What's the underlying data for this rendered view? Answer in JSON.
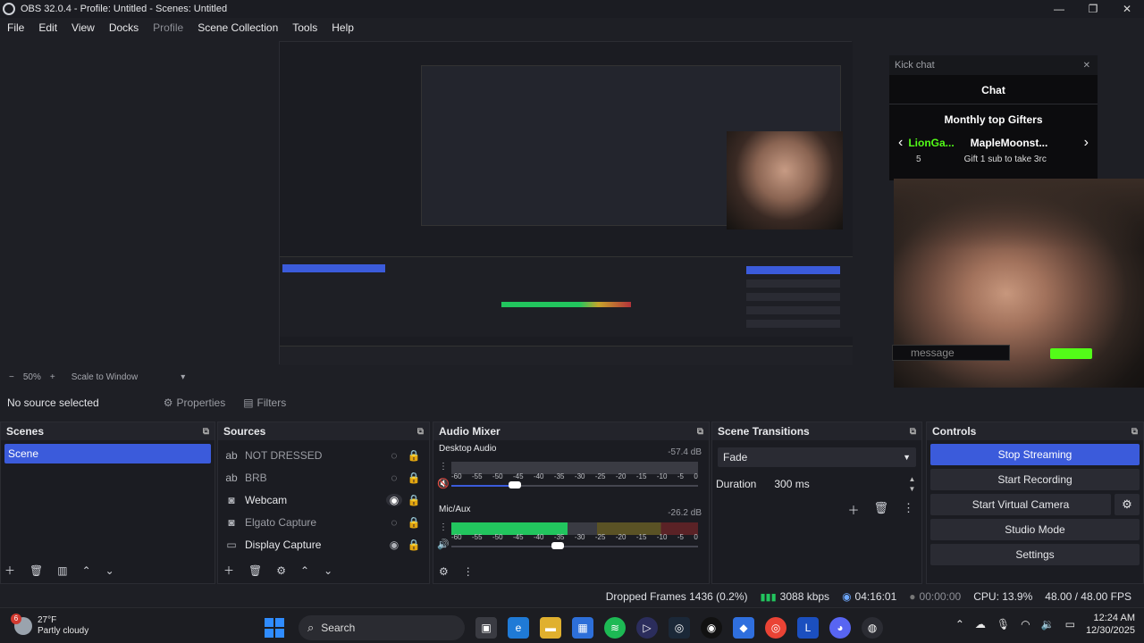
{
  "window": {
    "title": "OBS 32.0.4 - Profile: Untitled - Scenes: Untitled",
    "controls": [
      "—",
      "❐",
      "✕"
    ]
  },
  "menu": [
    "File",
    "Edit",
    "View",
    "Docks",
    "Profile",
    "Scene Collection",
    "Tools",
    "Help"
  ],
  "preview": {
    "chat": {
      "header": "Kick chat",
      "title": "Chat",
      "gifters_title": "Monthly top Gifters",
      "gifter_1": "LionGa...",
      "gifter_1_count": "5",
      "gifter_2": "MapleMoonst...",
      "gift_desc": "Gift 1 sub to take 3rc",
      "message_placeholder": "message"
    },
    "zoom": "50%",
    "scale_mode": "Scale to Window"
  },
  "context_bar": {
    "no_source": "No source selected",
    "properties": "Properties",
    "filters": "Filters"
  },
  "scenes": {
    "title": "Scenes",
    "items": [
      "Scene"
    ]
  },
  "sources": {
    "title": "Sources",
    "items": [
      {
        "name": "NOT DRESSED",
        "icon": "text-icon",
        "visible": false
      },
      {
        "name": "BRB",
        "icon": "text-icon",
        "visible": false
      },
      {
        "name": "Webcam",
        "icon": "camera-icon",
        "visible": true
      },
      {
        "name": "Elgato Capture",
        "icon": "camera-icon",
        "visible": false
      },
      {
        "name": "Display Capture",
        "icon": "monitor-icon",
        "visible": true
      }
    ]
  },
  "mixer": {
    "title": "Audio Mixer",
    "channels": [
      {
        "name": "Desktop Audio",
        "db": "-57.4 dB",
        "muted": true,
        "level": 0.0,
        "volume": 0.3
      },
      {
        "name": "Mic/Aux",
        "db": "-26.2 dB",
        "muted": false,
        "level": 0.47,
        "volume": 0.4
      }
    ],
    "scale": [
      "-60",
      "-55",
      "-50",
      "-45",
      "-40",
      "-35",
      "-30",
      "-25",
      "-20",
      "-15",
      "-10",
      "-5",
      "0"
    ]
  },
  "transitions": {
    "title": "Scene Transitions",
    "selected": "Fade",
    "duration_label": "Duration",
    "duration_value": "300 ms"
  },
  "controls": {
    "title": "Controls",
    "stop_streaming": "Stop Streaming",
    "start_recording": "Start Recording",
    "start_virtual_camera": "Start Virtual Camera",
    "studio_mode": "Studio Mode",
    "settings": "Settings"
  },
  "status": {
    "dropped": "Dropped Frames 1436 (0.2%)",
    "kbps": "3088 kbps",
    "live_time": "04:16:01",
    "rec_time": "00:00:00",
    "cpu": "CPU: 13.9%",
    "fps": "48.00 / 48.00 FPS"
  },
  "taskbar": {
    "temp": "27°F",
    "weather": "Partly cloudy",
    "weather_badge": "6",
    "search": "Search",
    "time": "12:24 AM",
    "date": "12/30/2025"
  },
  "colors": {
    "accent": "#3b5bdb",
    "meter_green": "#22c55e",
    "kick_green": "#53fc18"
  }
}
